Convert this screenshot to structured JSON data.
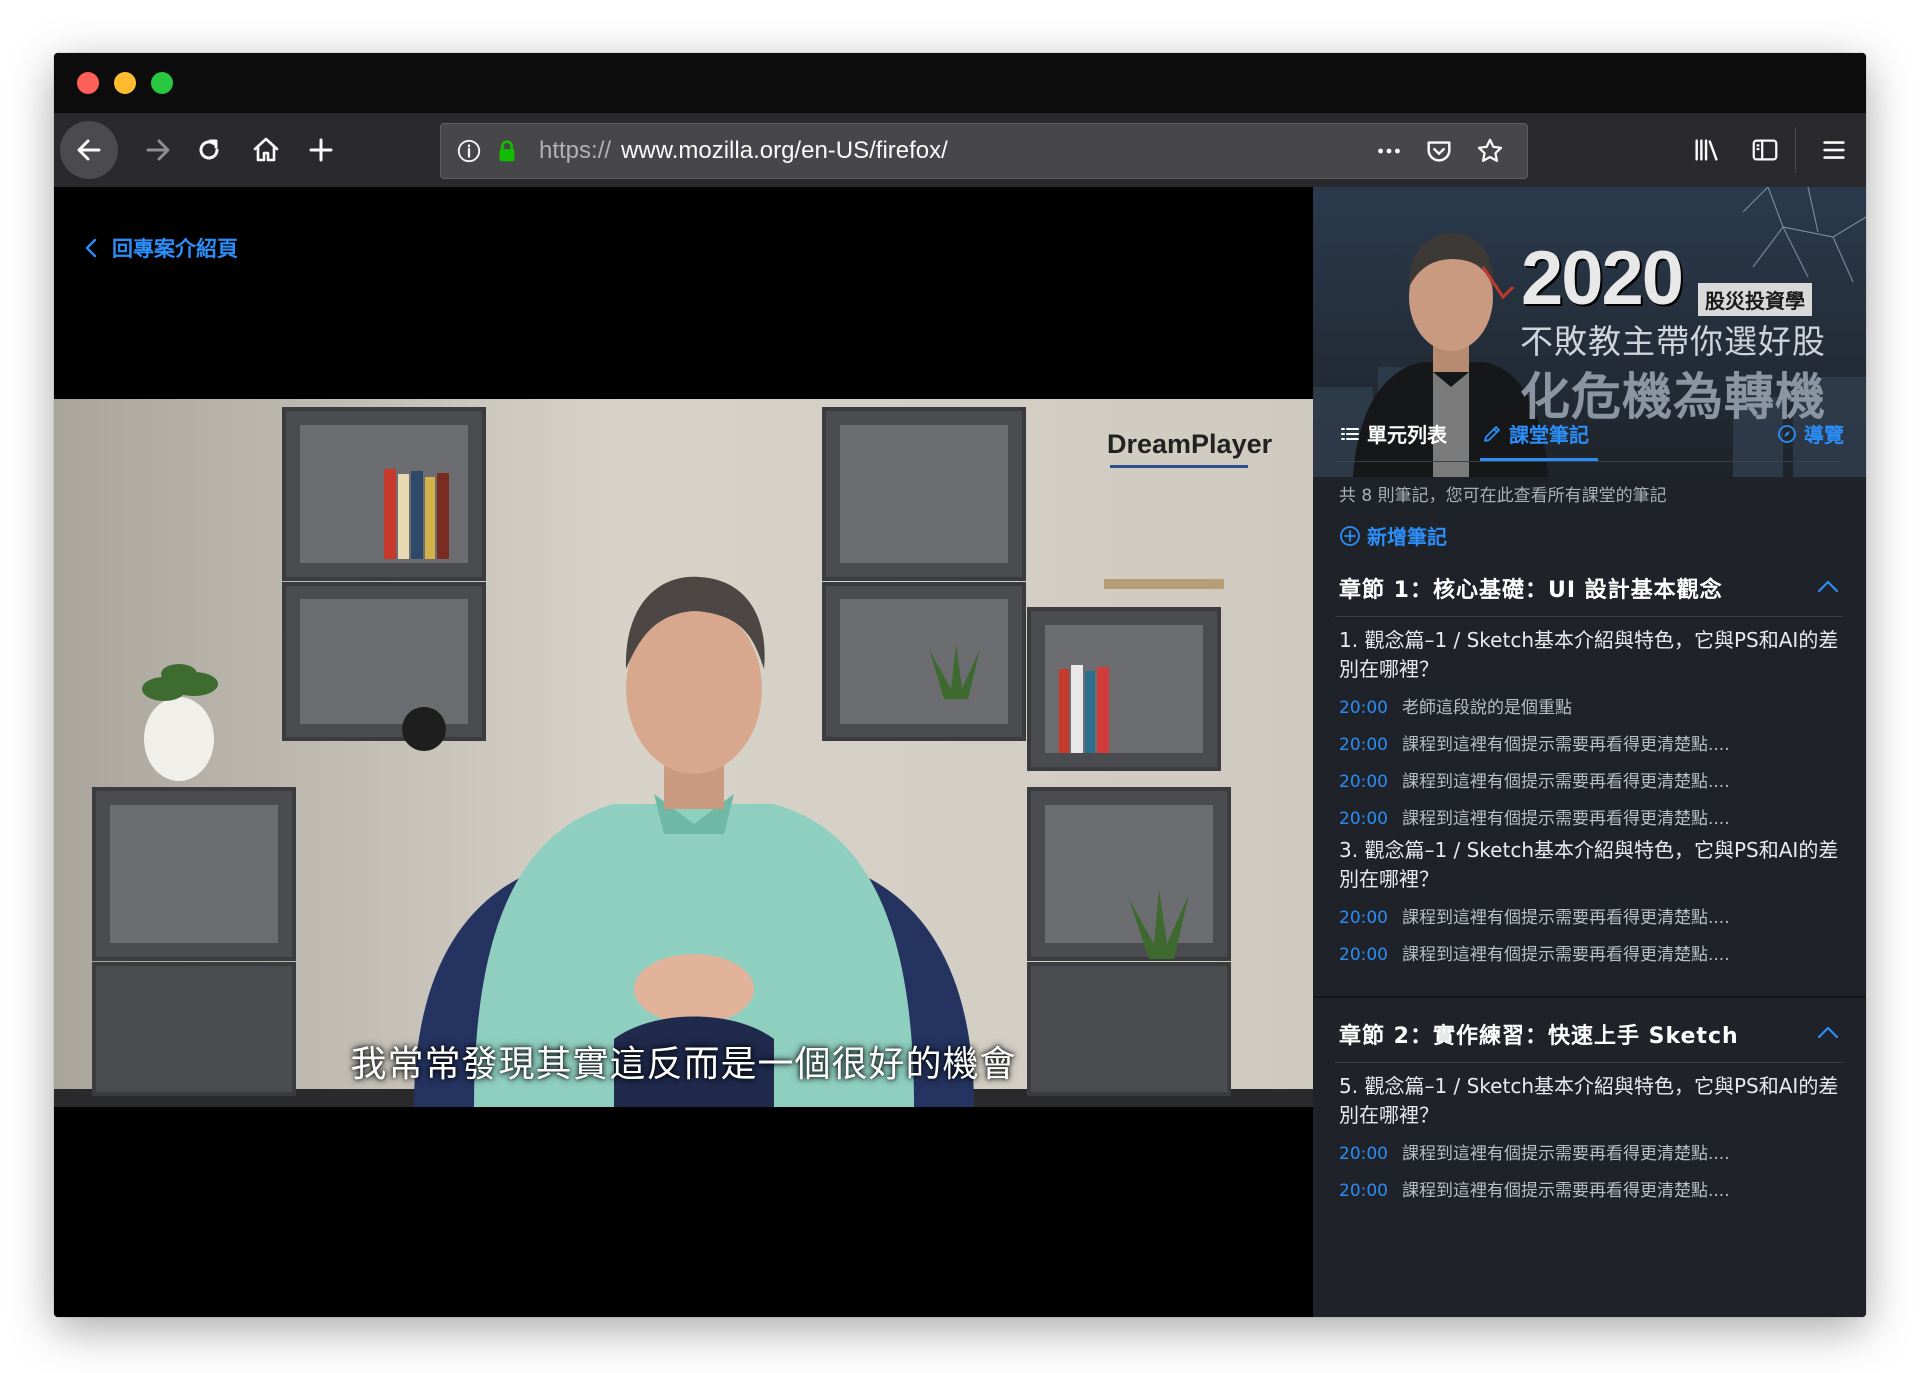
{
  "browser": {
    "url_protocol": "https://",
    "url_host": "www.mozilla.org/en-US/firefox/"
  },
  "player": {
    "back_link": "回專案介紹頁",
    "subtitle": "我常常發現其實這反而是一個很好的機會",
    "brand_logo": "DreamPlayer"
  },
  "banner": {
    "year": "2020",
    "tag": "股災投資學",
    "line2": "不敗教主帶你選好股",
    "line3": "化危機為轉機"
  },
  "tabs": {
    "units": "單元列表",
    "notes": "課堂筆記",
    "guide": "導覽"
  },
  "notes_panel": {
    "count_text": "共 8 則筆記，您可在此查看所有課堂的筆記",
    "add_note": "新增筆記",
    "chapters": [
      {
        "title": "章節 1：核心基礎：UI 設計基本觀念",
        "groups": [
          {
            "title": "1. 觀念篇–1 / Sketch基本介紹與特色，它與PS和AI的差別在哪裡？",
            "notes": [
              {
                "time": "20:00",
                "text": "老師這段說的是個重點"
              },
              {
                "time": "20:00",
                "text": "課程到這裡有個提示需要再看得更清楚點...."
              },
              {
                "time": "20:00",
                "text": "課程到這裡有個提示需要再看得更清楚點...."
              },
              {
                "time": "20:00",
                "text": "課程到這裡有個提示需要再看得更清楚點...."
              }
            ]
          },
          {
            "title": "3. 觀念篇–1 / Sketch基本介紹與特色，它與PS和AI的差別在哪裡？",
            "notes": [
              {
                "time": "20:00",
                "text": "課程到這裡有個提示需要再看得更清楚點...."
              },
              {
                "time": "20:00",
                "text": "課程到這裡有個提示需要再看得更清楚點...."
              }
            ]
          }
        ]
      },
      {
        "title": "章節 2：實作練習：快速上手 Sketch",
        "groups": [
          {
            "title": "5. 觀念篇–1 / Sketch基本介紹與特色，它與PS和AI的差別在哪裡？",
            "notes": [
              {
                "time": "20:00",
                "text": "課程到這裡有個提示需要再看得更清楚點...."
              },
              {
                "time": "20:00",
                "text": "課程到這裡有個提示需要再看得更清楚點...."
              }
            ]
          }
        ]
      }
    ]
  },
  "colors": {
    "accent": "#2b8df5",
    "panel_bg": "#1f2329",
    "toolbar_bg": "#2a2a2e"
  }
}
